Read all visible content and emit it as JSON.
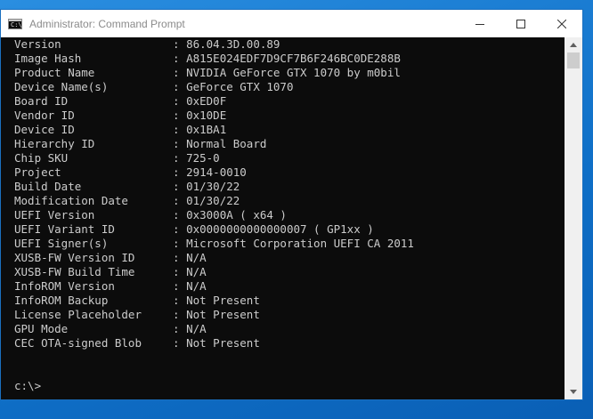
{
  "window": {
    "title": "Administrator: Command Prompt",
    "icon_label": "C:\\"
  },
  "console": {
    "rows": [
      {
        "key": "Version",
        "value": "86.04.3D.00.89"
      },
      {
        "key": "Image Hash",
        "value": "A815E024EDF7D9CF7B6F246BC0DE288B"
      },
      {
        "key": "Product Name",
        "value": "NVIDIA GeForce GTX 1070 by m0bil"
      },
      {
        "key": "Device Name(s)",
        "value": "GeForce GTX 1070"
      },
      {
        "key": "Board ID",
        "value": "0xED0F"
      },
      {
        "key": "Vendor ID",
        "value": "0x10DE"
      },
      {
        "key": "Device ID",
        "value": "0x1BA1"
      },
      {
        "key": "Hierarchy ID",
        "value": "Normal Board"
      },
      {
        "key": "Chip SKU",
        "value": "725-0"
      },
      {
        "key": "Project",
        "value": "2914-0010"
      },
      {
        "key": "Build Date",
        "value": "01/30/22"
      },
      {
        "key": "Modification Date",
        "value": "01/30/22"
      },
      {
        "key": "UEFI Version",
        "value": "0x3000A ( x64 )"
      },
      {
        "key": "UEFI Variant ID",
        "value": "0x0000000000000007 ( GP1xx )"
      },
      {
        "key": "UEFI Signer(s)",
        "value": "Microsoft Corporation UEFI CA 2011"
      },
      {
        "key": "XUSB-FW Version ID",
        "value": "N/A"
      },
      {
        "key": "XUSB-FW Build Time",
        "value": "N/A"
      },
      {
        "key": "InfoROM Version",
        "value": "N/A"
      },
      {
        "key": "InfoROM Backup",
        "value": "Not Present"
      },
      {
        "key": "License Placeholder",
        "value": "Not Present"
      },
      {
        "key": "GPU Mode",
        "value": "N/A"
      },
      {
        "key": "CEC OTA-signed Blob",
        "value": "Not Present"
      }
    ],
    "separator": ": ",
    "prompt": "c:\\>"
  },
  "icons": {
    "minimize": "minimize-icon",
    "maximize": "maximize-icon",
    "close": "close-icon"
  }
}
